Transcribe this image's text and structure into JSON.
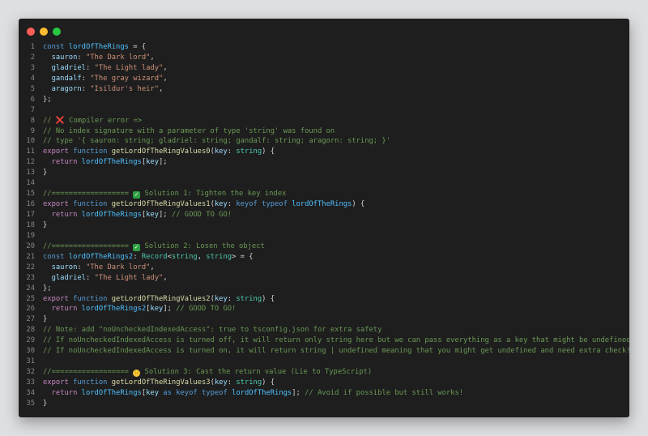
{
  "window": {
    "colors": {
      "background": "#1e1e1e",
      "close": "#ff5f57",
      "minimize": "#febc2e",
      "maximize": "#28c840"
    }
  },
  "icons": {
    "cross": "❌",
    "check": "✓",
    "face": "🤫"
  },
  "lines": [
    [
      {
        "c": "kw",
        "t": "const "
      },
      {
        "c": "var",
        "t": "lordOfTheRings"
      },
      {
        "c": "pun",
        "t": " = {"
      }
    ],
    [
      {
        "c": "pun",
        "t": "  "
      },
      {
        "c": "prop",
        "t": "sauron"
      },
      {
        "c": "pun",
        "t": ": "
      },
      {
        "c": "str",
        "t": "\"The Dark lord\""
      },
      {
        "c": "pun",
        "t": ","
      }
    ],
    [
      {
        "c": "pun",
        "t": "  "
      },
      {
        "c": "prop",
        "t": "gladriel"
      },
      {
        "c": "pun",
        "t": ": "
      },
      {
        "c": "str",
        "t": "\"The Light lady\""
      },
      {
        "c": "pun",
        "t": ","
      }
    ],
    [
      {
        "c": "pun",
        "t": "  "
      },
      {
        "c": "prop",
        "t": "gandalf"
      },
      {
        "c": "pun",
        "t": ": "
      },
      {
        "c": "str",
        "t": "\"The gray wizard\""
      },
      {
        "c": "pun",
        "t": ","
      }
    ],
    [
      {
        "c": "pun",
        "t": "  "
      },
      {
        "c": "prop",
        "t": "aragorn"
      },
      {
        "c": "pun",
        "t": ": "
      },
      {
        "c": "str",
        "t": "\"Isildur's heir\""
      },
      {
        "c": "pun",
        "t": ","
      }
    ],
    [
      {
        "c": "pun",
        "t": "};"
      }
    ],
    [],
    [
      {
        "c": "cm",
        "t": "// "
      },
      {
        "c": "icon-cross",
        "t": ""
      },
      {
        "c": "cm",
        "t": " Compiler error =>"
      }
    ],
    [
      {
        "c": "cm",
        "t": "// No index signature with a parameter of type 'string' was found on"
      }
    ],
    [
      {
        "c": "cm",
        "t": "// type '{ sauron: string; gladriel: string; gandalf: string; aragorn: string; }'"
      }
    ],
    [
      {
        "c": "kwc",
        "t": "export "
      },
      {
        "c": "kw",
        "t": "function "
      },
      {
        "c": "fn",
        "t": "getLordOfTheRingValues0"
      },
      {
        "c": "pun",
        "t": "("
      },
      {
        "c": "prop",
        "t": "key"
      },
      {
        "c": "pun",
        "t": ": "
      },
      {
        "c": "type",
        "t": "string"
      },
      {
        "c": "pun",
        "t": ") {"
      }
    ],
    [
      {
        "c": "pun",
        "t": "  "
      },
      {
        "c": "kwc",
        "t": "return "
      },
      {
        "c": "var",
        "t": "lordOfTheRings"
      },
      {
        "c": "pun",
        "t": "["
      },
      {
        "c": "prop",
        "t": "key"
      },
      {
        "c": "pun",
        "t": "];"
      }
    ],
    [
      {
        "c": "pun",
        "t": "}"
      }
    ],
    [],
    [
      {
        "c": "cm",
        "t": "//================== "
      },
      {
        "c": "icon-check",
        "t": ""
      },
      {
        "c": "cm",
        "t": " Solution 1: Tighten the key index"
      }
    ],
    [
      {
        "c": "kwc",
        "t": "export "
      },
      {
        "c": "kw",
        "t": "function "
      },
      {
        "c": "fn",
        "t": "getLordOfTheRingValues1"
      },
      {
        "c": "pun",
        "t": "("
      },
      {
        "c": "prop",
        "t": "key"
      },
      {
        "c": "pun",
        "t": ": "
      },
      {
        "c": "kw",
        "t": "keyof typeof "
      },
      {
        "c": "var",
        "t": "lordOfTheRings"
      },
      {
        "c": "pun",
        "t": ") {"
      }
    ],
    [
      {
        "c": "pun",
        "t": "  "
      },
      {
        "c": "kwc",
        "t": "return "
      },
      {
        "c": "var",
        "t": "lordOfTheRings"
      },
      {
        "c": "pun",
        "t": "["
      },
      {
        "c": "prop",
        "t": "key"
      },
      {
        "c": "pun",
        "t": "]; "
      },
      {
        "c": "cm",
        "t": "// GOOD TO GO!"
      }
    ],
    [
      {
        "c": "pun",
        "t": "}"
      }
    ],
    [],
    [
      {
        "c": "cm",
        "t": "//================== "
      },
      {
        "c": "icon-check",
        "t": ""
      },
      {
        "c": "cm",
        "t": " Solution 2: Losen the object"
      }
    ],
    [
      {
        "c": "kw",
        "t": "const "
      },
      {
        "c": "var",
        "t": "lordOfTheRings2"
      },
      {
        "c": "pun",
        "t": ": "
      },
      {
        "c": "type",
        "t": "Record"
      },
      {
        "c": "pun",
        "t": "<"
      },
      {
        "c": "type",
        "t": "string"
      },
      {
        "c": "pun",
        "t": ", "
      },
      {
        "c": "type",
        "t": "string"
      },
      {
        "c": "pun",
        "t": "> = {"
      }
    ],
    [
      {
        "c": "pun",
        "t": "  "
      },
      {
        "c": "prop",
        "t": "sauron"
      },
      {
        "c": "pun",
        "t": ": "
      },
      {
        "c": "str",
        "t": "\"The Dark lord\""
      },
      {
        "c": "pun",
        "t": ","
      }
    ],
    [
      {
        "c": "pun",
        "t": "  "
      },
      {
        "c": "prop",
        "t": "gladriel"
      },
      {
        "c": "pun",
        "t": ": "
      },
      {
        "c": "str",
        "t": "\"The Light lady\""
      },
      {
        "c": "pun",
        "t": ","
      }
    ],
    [
      {
        "c": "pun",
        "t": "};"
      }
    ],
    [
      {
        "c": "kwc",
        "t": "export "
      },
      {
        "c": "kw",
        "t": "function "
      },
      {
        "c": "fn",
        "t": "getLordOfTheRingValues2"
      },
      {
        "c": "pun",
        "t": "("
      },
      {
        "c": "prop",
        "t": "key"
      },
      {
        "c": "pun",
        "t": ": "
      },
      {
        "c": "type",
        "t": "string"
      },
      {
        "c": "pun",
        "t": ") {"
      }
    ],
    [
      {
        "c": "pun",
        "t": "  "
      },
      {
        "c": "kwc",
        "t": "return "
      },
      {
        "c": "var",
        "t": "lordOfTheRings2"
      },
      {
        "c": "pun",
        "t": "["
      },
      {
        "c": "prop",
        "t": "key"
      },
      {
        "c": "pun",
        "t": "]; "
      },
      {
        "c": "cm",
        "t": "// GOOD TO GO!"
      }
    ],
    [
      {
        "c": "pun",
        "t": "}"
      }
    ],
    [
      {
        "c": "cm",
        "t": "// Note: add \"noUncheckedIndexedAccess\": true to tsconfig.json for extra safety"
      }
    ],
    [
      {
        "c": "cm",
        "t": "// If noUncheckedIndexedAccess is turned off, it will return only string here but we can pass everything as a key that might be undefined"
      }
    ],
    [
      {
        "c": "cm",
        "t": "// If noUncheckedIndexedAccess is turned on, it will return string | undefined meaning that you might get undefined and need extra check!"
      }
    ],
    [],
    [
      {
        "c": "cm",
        "t": "//================== "
      },
      {
        "c": "icon-face",
        "t": ""
      },
      {
        "c": "cm",
        "t": " Solution 3: Cast the return value (Lie to TypeScript)"
      }
    ],
    [
      {
        "c": "kwc",
        "t": "export "
      },
      {
        "c": "kw",
        "t": "function "
      },
      {
        "c": "fn",
        "t": "getLordOfTheRingValues3"
      },
      {
        "c": "pun",
        "t": "("
      },
      {
        "c": "prop",
        "t": "key"
      },
      {
        "c": "pun",
        "t": ": "
      },
      {
        "c": "type",
        "t": "string"
      },
      {
        "c": "pun",
        "t": ") {"
      }
    ],
    [
      {
        "c": "pun",
        "t": "  "
      },
      {
        "c": "kwc",
        "t": "return "
      },
      {
        "c": "var",
        "t": "lordOfTheRings"
      },
      {
        "c": "pun",
        "t": "["
      },
      {
        "c": "prop",
        "t": "key"
      },
      {
        "c": "kw",
        "t": " as keyof typeof "
      },
      {
        "c": "var",
        "t": "lordOfTheRings"
      },
      {
        "c": "pun",
        "t": "]; "
      },
      {
        "c": "cm",
        "t": "// Avoid if possible but still works!"
      }
    ],
    [
      {
        "c": "pun",
        "t": "}"
      }
    ]
  ]
}
